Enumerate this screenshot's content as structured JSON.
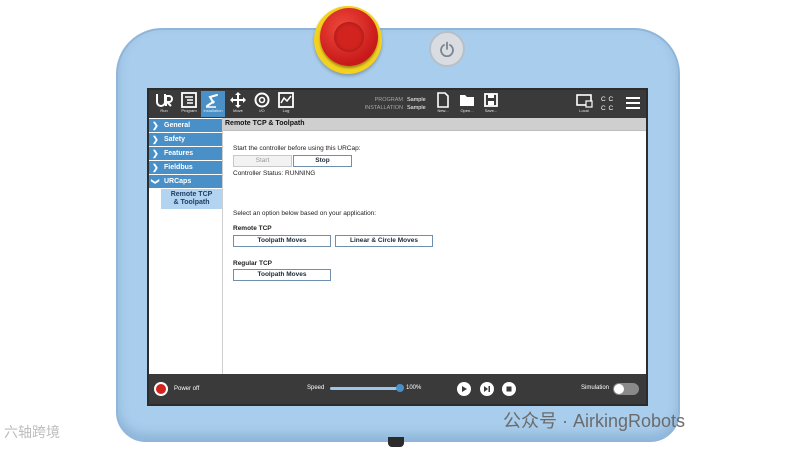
{
  "topbar": {
    "tabs": [
      {
        "label": "Run",
        "icon": "ur-logo-icon"
      },
      {
        "label": "Program",
        "icon": "program-icon"
      },
      {
        "label": "Installation",
        "icon": "installation-icon"
      },
      {
        "label": "Move",
        "icon": "move-arrows-icon"
      },
      {
        "label": "I/O",
        "icon": "io-icon"
      },
      {
        "label": "Log",
        "icon": "log-icon"
      }
    ],
    "program_label": "PROGRAM",
    "installation_label": "INSTALLATION",
    "program_value": "Sample",
    "installation_value": "Sample",
    "file_buttons": [
      {
        "label": "New...",
        "icon": "new-file-icon"
      },
      {
        "label": "Open...",
        "icon": "folder-icon"
      },
      {
        "label": "Save...",
        "icon": "save-icon"
      }
    ],
    "local_label": "Local",
    "cc_top": "C C",
    "cc_bottom": "C C"
  },
  "sidebar": {
    "items": [
      {
        "label": "General"
      },
      {
        "label": "Safety"
      },
      {
        "label": "Features"
      },
      {
        "label": "Fieldbus"
      },
      {
        "label": "URCaps",
        "expanded": true
      }
    ],
    "sub_items": [
      {
        "line1": "Remote TCP",
        "line2": "& Toolpath",
        "selected": true
      }
    ]
  },
  "content": {
    "header": "Remote TCP & Toolpath",
    "start_prompt": "Start the controller before using this URCap:",
    "start_button": "Start",
    "stop_button": "Stop",
    "controller_status": "Controller Status: RUNNING",
    "option_prompt": "Select an option below based on your application:",
    "remote_tcp_heading": "Remote TCP",
    "remote_toolpath_button": "Toolpath Moves",
    "remote_linear_button": "Linear & Circle Moves",
    "regular_tcp_heading": "Regular TCP",
    "regular_toolpath_button": "Toolpath Moves"
  },
  "bottombar": {
    "power_label": "Power off",
    "speed_label": "Speed",
    "speed_value": "100%",
    "speed_fraction": 1.0,
    "simulation_label": "Simulation",
    "simulation_on": false
  },
  "colors": {
    "accent": "#4a90c8",
    "bar": "#3a3a3a",
    "estop": "#d2231f",
    "estop_ring": "#f3d11f",
    "pendant": "#a9cdec"
  },
  "watermark": {
    "left": "六轴跨境",
    "right": "公众号 · AirkingRobots"
  }
}
